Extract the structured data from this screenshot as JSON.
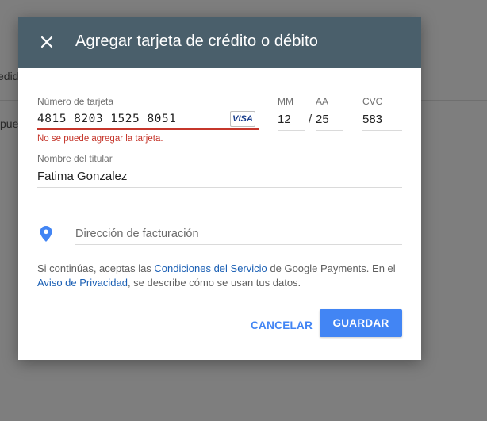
{
  "background": {
    "text_top": "edid",
    "text_mid": "pue"
  },
  "dialog": {
    "title": "Agregar tarjeta de crédito o débito",
    "close_icon": "close-icon"
  },
  "card_number": {
    "label": "Número de tarjeta",
    "value": "4815 8203 1525 8051",
    "brand": "VISA",
    "error": "No se puede agregar la tarjeta."
  },
  "expiry": {
    "mm_label": "MM",
    "mm_value": "12",
    "separator": "/",
    "aa_label": "AA",
    "aa_value": "25"
  },
  "cvc": {
    "label": "CVC",
    "value": "583"
  },
  "holder": {
    "label": "Nombre del titular",
    "value": "Fatima Gonzalez"
  },
  "billing": {
    "icon": "location-pin-icon",
    "placeholder": "Dirección de facturación"
  },
  "legal": {
    "part1": "Si continúas, aceptas las ",
    "link1": "Condiciones del Servicio",
    "part2": " de Google Payments. En el ",
    "link2": "Aviso de Privacidad",
    "part3": ", se describe cómo se usan tus datos."
  },
  "actions": {
    "cancel": "CANCELAR",
    "save": "GUARDAR"
  },
  "colors": {
    "header": "#4a5f6b",
    "accent": "#4285f4",
    "error": "#c5362b",
    "link": "#1a5fb4"
  }
}
